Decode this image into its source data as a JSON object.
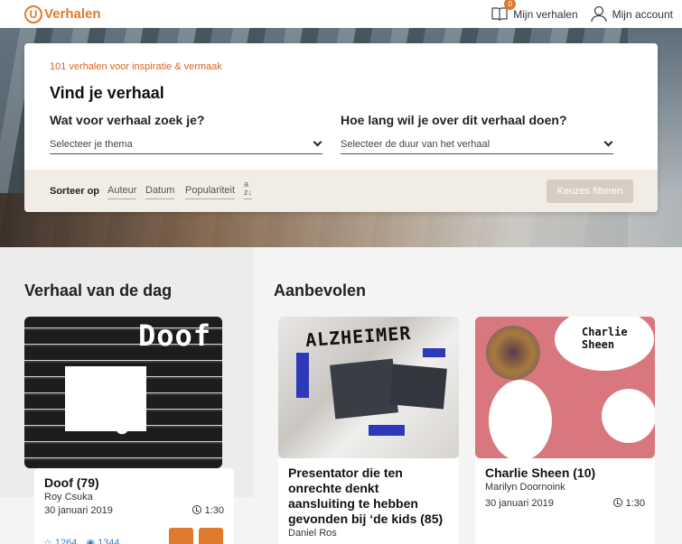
{
  "header": {
    "logo_letter": "U",
    "logo_text": "Verhalen",
    "my_stories_count": "0",
    "my_stories_label": "Mijn verhalen",
    "account_label": "Mijn account"
  },
  "search": {
    "subtitle": "101 verhalen voor inspiratie & vermaak",
    "title": "Vind je verhaal",
    "theme_question": "Wat voor verhaal zoek je?",
    "theme_placeholder": "Selecteer je thema",
    "duration_question": "Hoe lang wil je over dit verhaal doen?",
    "duration_placeholder": "Selecteer de duur van het verhaal",
    "sort_label": "Sorteer op",
    "sort_options": [
      "Auteur",
      "Datum",
      "Populariteit"
    ],
    "az_top": "a",
    "az_bottom": "z",
    "filter_button": "Keuzes filteren"
  },
  "story_of_day": {
    "section_title": "Verhaal van de dag",
    "cover_word": "Doof",
    "title": "Doof (79)",
    "author": "Roy Csuka",
    "date": "30 januari 2019",
    "duration": "1:30",
    "likes": "1264",
    "views": "1344"
  },
  "recommended": {
    "section_title": "Aanbevolen",
    "items": [
      {
        "cover_word": "ALZHEIMER",
        "title": "Presentator die ten onrechte denkt aansluiting te hebben gevonden bij ‘de kids (85)",
        "author": "Daniel Ros"
      },
      {
        "cover_word_1": "Charlie",
        "cover_word_2": "Sheen",
        "title": "Charlie Sheen (10)",
        "author": "Marilyn Doornoink",
        "date": "30 januari 2019",
        "duration": "1:30"
      }
    ]
  },
  "colors": {
    "accent": "#e07a2e",
    "link_blue": "#3a7fd0"
  },
  "icons": {
    "logo": "u-circle-icon",
    "book": "book-icon",
    "user": "user-icon",
    "chevron": "chevron-down-icon",
    "clock": "clock-icon",
    "like": "thumbs-up-icon",
    "views": "eye-icon"
  }
}
